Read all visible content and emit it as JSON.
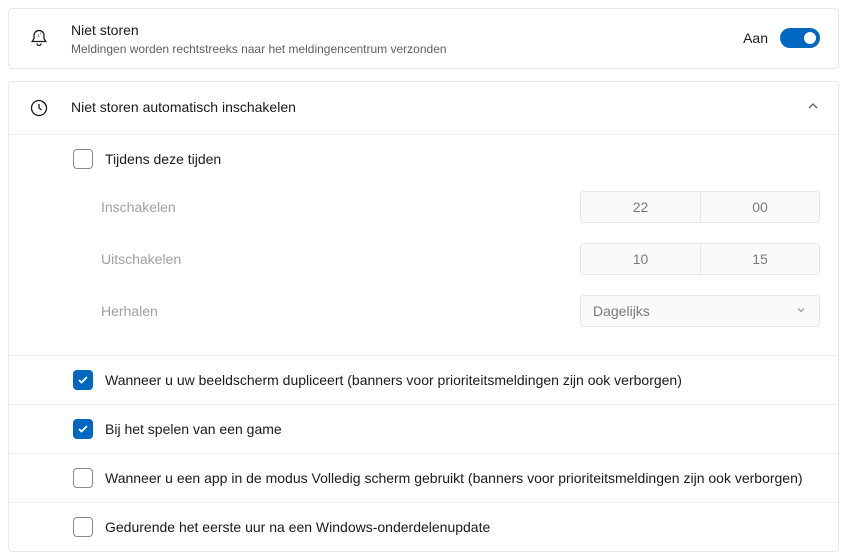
{
  "dnd": {
    "title": "Niet storen",
    "subtitle": "Meldingen worden rechtstreeks naar het meldingencentrum verzonden",
    "state_label": "Aan"
  },
  "auto": {
    "title": "Niet storen automatisch inschakelen",
    "during_times_label": "Tijdens deze tijden",
    "enable_label": "Inschakelen",
    "enable_hour": "22",
    "enable_min": "00",
    "disable_label": "Uitschakelen",
    "disable_hour": "10",
    "disable_min": "15",
    "repeat_label": "Herhalen",
    "repeat_value": "Dagelijks",
    "options": {
      "duplicating": "Wanneer u uw beeldscherm dupliceert (banners voor prioriteitsmeldingen zijn ook verborgen)",
      "gaming": "Bij het spelen van een game",
      "fullscreen": "Wanneer u een app in de modus Volledig scherm gebruikt (banners voor prioriteitsmeldingen zijn ook verborgen)",
      "after_update": "Gedurende het eerste uur na een Windows-onderdelenupdate"
    }
  }
}
